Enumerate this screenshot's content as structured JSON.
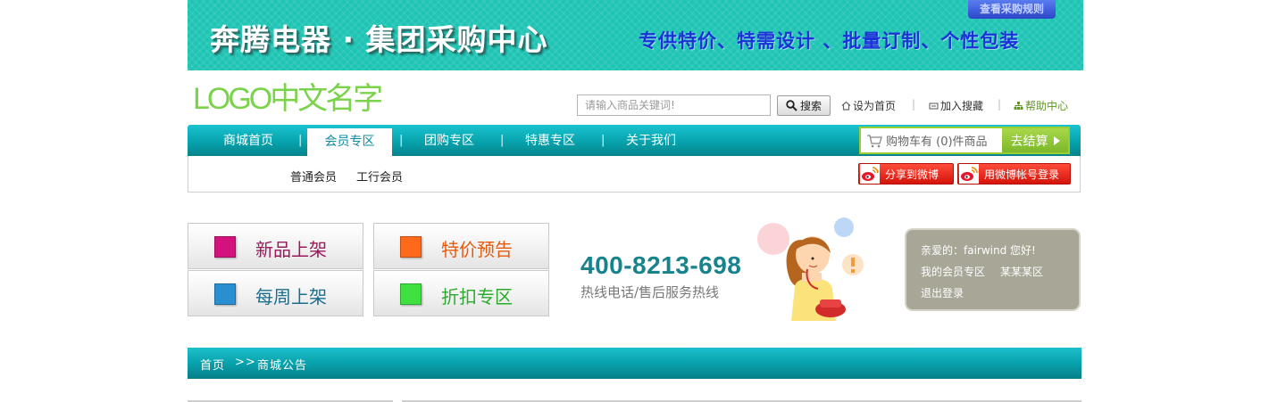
{
  "banner": {
    "title": "奔腾电器 · 集团采购中心",
    "subtitle": "专供特价、特需设计 、批量订制、个性包装",
    "rules_button": "查看采购规则"
  },
  "logo": {
    "text": "LOGO中文名字"
  },
  "search": {
    "placeholder": "请输入商品关键词!",
    "button_label": "搜索"
  },
  "toplinks": {
    "home": "设为首页",
    "favorite": "加入搜藏",
    "help": "帮助中心",
    "separator": "|"
  },
  "nav": {
    "items": [
      {
        "label": "商城首页"
      },
      {
        "label": "会员专区"
      },
      {
        "label": "团购专区"
      },
      {
        "label": "特惠专区"
      },
      {
        "label": "关于我们"
      }
    ],
    "separator": "|"
  },
  "cart": {
    "text": "购物车有 (0)件商品",
    "checkout_label": "去结算"
  },
  "subnav": {
    "items": [
      {
        "label": "普通会员"
      },
      {
        "label": "工行会员"
      }
    ]
  },
  "share": {
    "weibo_share": "分享到微博",
    "weibo_login": "用微博帐号登录"
  },
  "features": [
    {
      "label": "新品上架",
      "color": "#d4127e",
      "text_color": "#9b1a5c"
    },
    {
      "label": "特价预告",
      "color": "#ff6a1a",
      "text_color": "#e65a0a"
    },
    {
      "label": "每周上架",
      "color": "#2a8fd0",
      "text_color": "#1a6e8e"
    },
    {
      "label": "折扣专区",
      "color": "#40e040",
      "text_color": "#2aaa2a"
    }
  ],
  "hotline": {
    "number": "400-8213-698",
    "caption": "热线电话/售后服务热线"
  },
  "member": {
    "greeting": "亲爱的：fairwind 您好!",
    "zone_link": "我的会员专区",
    "zone_name": "某某某区",
    "logout": "退出登录"
  },
  "breadcrumb": {
    "home": "首页",
    "separator": ">>",
    "current": "商城公告"
  },
  "colors": {
    "teal": "#07a3ad",
    "banner": "#1ec4b4",
    "green_accent": "#9acd32",
    "member_box": "#a8a696"
  }
}
